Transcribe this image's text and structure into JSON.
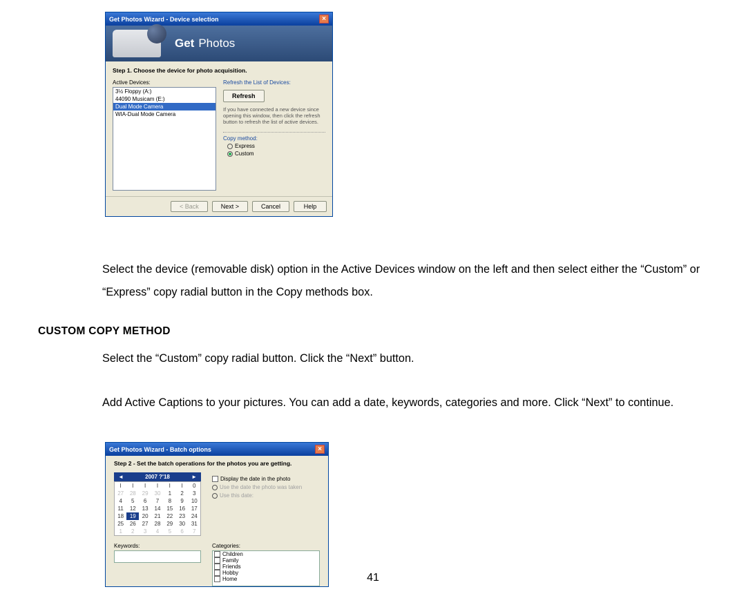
{
  "dialog1": {
    "title": "Get Photos Wizard - Device selection",
    "banner_get": "Get",
    "banner_photos": "Photos",
    "step": "Step 1. Choose the device for photo acquisition.",
    "active_devices_label": "Active Devices:",
    "devices": {
      "d0": "3½ Floppy (A:)",
      "d1": "44090 Musicam (E:)",
      "d2": "Dual Mode Camera",
      "d3": "WIA-Dual Mode Camera"
    },
    "refresh_label_header": "Refresh the List of Devices:",
    "refresh_btn": "Refresh",
    "hint": "If you have connected a new device since opening this window, then click the refresh button to refresh the list of active devices.",
    "copy_method_label": "Copy method:",
    "opt_express": "Express",
    "opt_custom": "Custom",
    "btn_back": "< Back",
    "btn_next": "Next >",
    "btn_cancel": "Cancel",
    "btn_help": "Help"
  },
  "text": {
    "p1": "Select the device (removable disk) option in the Active Devices window on the left and then select either the “Custom” or “Express” copy radial button in the Copy methods box.",
    "h2": "CUSTOM COPY METHOD",
    "p2": "Select the “Custom” copy radial button. Click the “Next” button.",
    "p3": "Add Active Captions to your pictures. You can add a date, keywords, categories and more. Click “Next” to continue."
  },
  "dialog2": {
    "title": "Get Photos Wizard - Batch options",
    "step": "Step 2 - Set the batch operations for the photos you are getting.",
    "cal_month": "2007 ?'18",
    "opt_display_date": "Display the date in the photo",
    "opt_use_taken": "Use the date the photo was taken",
    "opt_use_this": "Use this date:",
    "keywords_label": "Keywords:",
    "categories_label": "Categories:",
    "cats": {
      "c0": "Children",
      "c1": "Family",
      "c2": "Friends",
      "c3": "Hobby",
      "c4": "Home"
    },
    "cal": {
      "dow": {
        "d0": "I",
        "d1": "I",
        "d2": "I",
        "d3": "I",
        "d4": "I",
        "d5": "I",
        "d6": "0"
      },
      "w1": {
        "c0": "27",
        "c1": "28",
        "c2": "29",
        "c3": "30",
        "c4": "1",
        "c5": "2",
        "c6": "3"
      },
      "w2": {
        "c0": "4",
        "c1": "5",
        "c2": "6",
        "c3": "7",
        "c4": "8",
        "c5": "9",
        "c6": "10"
      },
      "w3": {
        "c0": "11",
        "c1": "12",
        "c2": "13",
        "c3": "14",
        "c4": "15",
        "c5": "16",
        "c6": "17"
      },
      "w4": {
        "c0": "18",
        "c1": "19",
        "c2": "20",
        "c3": "21",
        "c4": "22",
        "c5": "23",
        "c6": "24"
      },
      "w5": {
        "c0": "25",
        "c1": "26",
        "c2": "27",
        "c3": "28",
        "c4": "29",
        "c5": "30",
        "c6": "31"
      },
      "w6": {
        "c0": "1",
        "c1": "2",
        "c2": "3",
        "c3": "4",
        "c4": "5",
        "c5": "6",
        "c6": "7"
      }
    }
  },
  "page_number": "41"
}
